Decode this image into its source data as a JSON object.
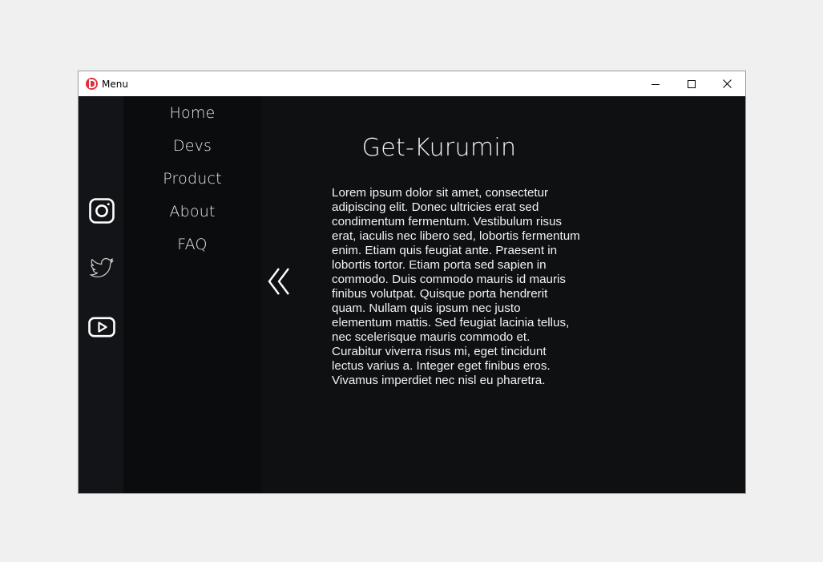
{
  "window": {
    "title": "Menu",
    "controls": {
      "minimize": "minimize-icon",
      "maximize": "maximize-icon",
      "close": "close-icon"
    }
  },
  "nav": {
    "items": [
      {
        "label": "Home"
      },
      {
        "label": "Devs"
      },
      {
        "label": "Product"
      },
      {
        "label": "About"
      },
      {
        "label": "FAQ"
      }
    ]
  },
  "social": {
    "icons": [
      "instagram-icon",
      "twitter-icon",
      "youtube-icon"
    ]
  },
  "main": {
    "title": "Get-Kurumin",
    "body": "Lorem ipsum dolor sit amet, consectetur adipiscing elit. Donec ultricies erat sed condimentum fermentum. Vestibulum risus erat, iaculis nec libero sed, lobortis fermentum enim. Etiam quis feugiat ante. Praesent in lobortis tortor. Etiam porta sed sapien in commodo. Duis commodo mauris id mauris finibus volutpat. Quisque porta hendrerit quam. Nullam quis ipsum nec justo elementum mattis. Sed feugiat lacinia tellus, nec scelerisque mauris commodo et. Curabitur viverra risus mi, eget tincidunt lectus varius a. Integer eget finibus eros. Vivamus imperdiet nec nisl eu pharetra."
  },
  "colors": {
    "background": "#0e1012",
    "social_bar": "#121417",
    "nav_panel": "#0b0c0e",
    "text": "#f2f2f2",
    "app_icon": "#e0313b"
  }
}
